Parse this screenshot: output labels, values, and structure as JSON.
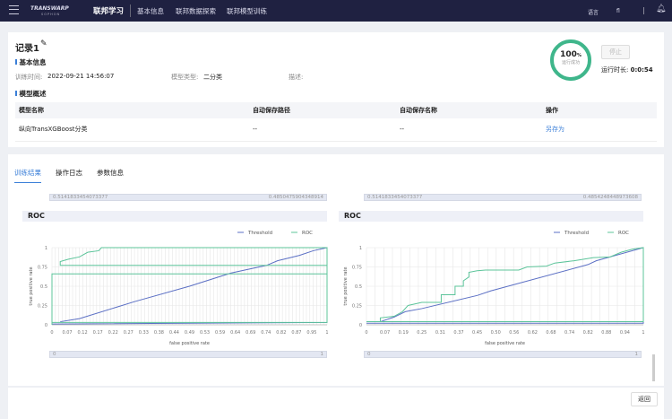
{
  "topbar": {
    "logo": "TRANSWARP",
    "logo_sub": "SOPHON",
    "app": "联邦学习",
    "nav": [
      "基本信息",
      "联邦数据探索",
      "联邦模型训练"
    ],
    "lang": "语言",
    "user": "fl"
  },
  "record": {
    "title": "记录1",
    "basic_info": "基本信息",
    "train_time_label": "训练时间:",
    "train_time": "2022-09-21 14:56:07",
    "model_type_label": "模型类型:",
    "model_type": "二分类",
    "desc_label": "描述:",
    "progress_value": "100",
    "progress_unit": "%",
    "progress_status": "运行成功",
    "stop": "停止",
    "duration_label": "运行时长:",
    "duration": "0:0:54",
    "overview": "模型概述",
    "table": {
      "headers": [
        "模型名称",
        "自动保存路径",
        "自动保存名称",
        "操作"
      ],
      "rows": [
        [
          "纵向TransXGBoost分类",
          "--",
          "--",
          "另存为"
        ]
      ]
    }
  },
  "tabs": [
    "训练结果",
    "操作日志",
    "参数信息"
  ],
  "colors": {
    "threshold": "#5b6fc4",
    "roc": "#5cc49a",
    "accent": "#3b7fd8"
  },
  "chart_data": [
    {
      "type": "line",
      "title": "ROC",
      "xlabel": "false positive rate",
      "ylabel": "true positive rate",
      "slider_top": [
        "0.5141833454073377",
        "0.4850475904348914"
      ],
      "slider_bottom": [
        "0",
        "1"
      ],
      "xticks": [
        "0",
        "0.07",
        "0.12",
        "0.17",
        "0.22",
        "0.27",
        "0.33",
        "0.38",
        "0.44",
        "0.49",
        "0.53",
        "0.59",
        "0.64",
        "0.69",
        "0.74",
        "0.82",
        "0.87",
        "0.95",
        "1"
      ],
      "yticks": [
        "0",
        "0.25",
        "0.5",
        "0.75",
        "1"
      ],
      "ylim": [
        0,
        1
      ],
      "legend": [
        "Threshold",
        "ROC"
      ],
      "series": [
        {
          "name": "Threshold",
          "points": [
            [
              0.03,
              0.04
            ],
            [
              0.1,
              0.08
            ],
            [
              0.3,
              0.3
            ],
            [
              0.5,
              0.5
            ],
            [
              0.65,
              0.67
            ],
            [
              0.78,
              0.77
            ],
            [
              0.82,
              0.83
            ],
            [
              0.9,
              0.9
            ],
            [
              0.95,
              0.96
            ],
            [
              1,
              1
            ],
            [
              1,
              0.03
            ],
            [
              0,
              0.01
            ]
          ]
        },
        {
          "name": "ROC",
          "points": [
            [
              0,
              0
            ],
            [
              0,
              0.66
            ],
            [
              1,
              0.66
            ],
            [
              1,
              0.77
            ],
            [
              0.03,
              0.77
            ],
            [
              0.03,
              0.82
            ],
            [
              0.06,
              0.85
            ],
            [
              0.1,
              0.88
            ],
            [
              0.13,
              0.94
            ],
            [
              0.17,
              0.96
            ],
            [
              0.18,
              1
            ],
            [
              1,
              1
            ],
            [
              1,
              0.03
            ],
            [
              0,
              0.03
            ]
          ]
        }
      ]
    },
    {
      "type": "line",
      "title": "ROC",
      "xlabel": "false positive rate",
      "ylabel": "true positive rate",
      "slider_top": [
        "0.5141833454073377",
        "0.4854248448973608"
      ],
      "slider_bottom": [
        "0",
        "1"
      ],
      "xticks": [
        "0",
        "0.07",
        "0.19",
        "0.25",
        "0.31",
        "0.37",
        "0.45",
        "0.50",
        "0.56",
        "0.62",
        "0.68",
        "0.74",
        "0.82",
        "0.88",
        "0.94",
        "1"
      ],
      "yticks": [
        "0",
        "0.25",
        "0.5",
        "0.75",
        "1"
      ],
      "ylim": [
        0,
        1
      ],
      "legend": [
        "Threshold",
        "ROC"
      ],
      "series": [
        {
          "name": "Threshold",
          "points": [
            [
              0.05,
              0.04
            ],
            [
              0.1,
              0.1
            ],
            [
              0.14,
              0.17
            ],
            [
              0.2,
              0.21
            ],
            [
              0.4,
              0.38
            ],
            [
              0.45,
              0.44
            ],
            [
              0.8,
              0.78
            ],
            [
              0.83,
              0.83
            ],
            [
              1,
              1
            ],
            [
              1,
              0.02
            ],
            [
              0,
              0.02
            ]
          ]
        },
        {
          "name": "ROC",
          "points": [
            [
              0.05,
              0.04
            ],
            [
              0.05,
              0.09
            ],
            [
              0.1,
              0.11
            ],
            [
              0.13,
              0.17
            ],
            [
              0.15,
              0.25
            ],
            [
              0.2,
              0.29
            ],
            [
              0.27,
              0.29
            ],
            [
              0.27,
              0.39
            ],
            [
              0.32,
              0.39
            ],
            [
              0.32,
              0.5
            ],
            [
              0.35,
              0.5
            ],
            [
              0.35,
              0.57
            ],
            [
              0.37,
              0.62
            ],
            [
              0.37,
              0.68
            ],
            [
              0.4,
              0.7
            ],
            [
              0.43,
              0.71
            ],
            [
              0.55,
              0.71
            ],
            [
              0.58,
              0.75
            ],
            [
              0.65,
              0.76
            ],
            [
              0.68,
              0.8
            ],
            [
              0.75,
              0.83
            ],
            [
              0.82,
              0.87
            ],
            [
              0.88,
              0.88
            ],
            [
              0.92,
              0.94
            ],
            [
              0.96,
              0.98
            ],
            [
              1,
              1
            ],
            [
              1,
              0.04
            ],
            [
              0,
              0.04
            ]
          ]
        }
      ]
    }
  ],
  "footer": {
    "back": "返回"
  }
}
